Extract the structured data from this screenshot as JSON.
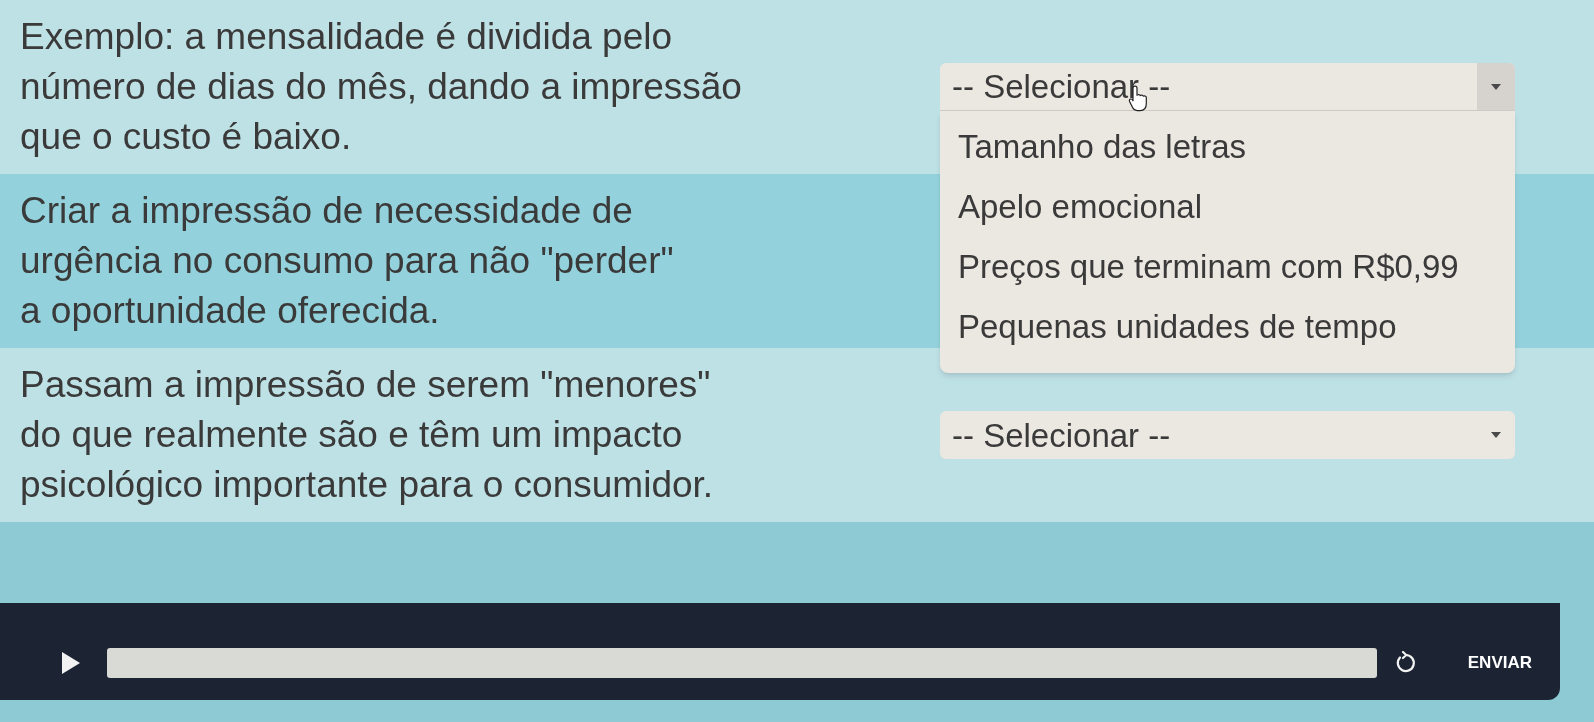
{
  "rows": [
    {
      "statement": [
        "Exemplo: a mensalidade é dividida pelo",
        "número de dias do mês, dando a impressão",
        "que o custo é baixo."
      ],
      "dropdown": {
        "value": "-- Selecionar --",
        "expanded": true,
        "options": [
          {
            "label": "Tamanho das letras",
            "selected": false
          },
          {
            "label": "Apelo emocional",
            "selected": false
          },
          {
            "label": "Preços que terminam com R$0,99",
            "selected": false
          },
          {
            "label": "Pequenas unidades de tempo",
            "selected": false
          }
        ]
      }
    },
    {
      "statement": [
        "Criar a impressão de necessidade de",
        "urgência no consumo para não \"perder\"",
        "a oportunidade oferecida."
      ]
    },
    {
      "statement": [
        "Passam a impressão de serem \"menores\"",
        "do que realmente são e têm um impacto",
        "psicológico importante para o consumidor."
      ],
      "dropdown": {
        "value": "-- Selecionar --",
        "expanded": false
      }
    }
  ],
  "player_bar": {
    "submit_button": "ENVIAR"
  }
}
